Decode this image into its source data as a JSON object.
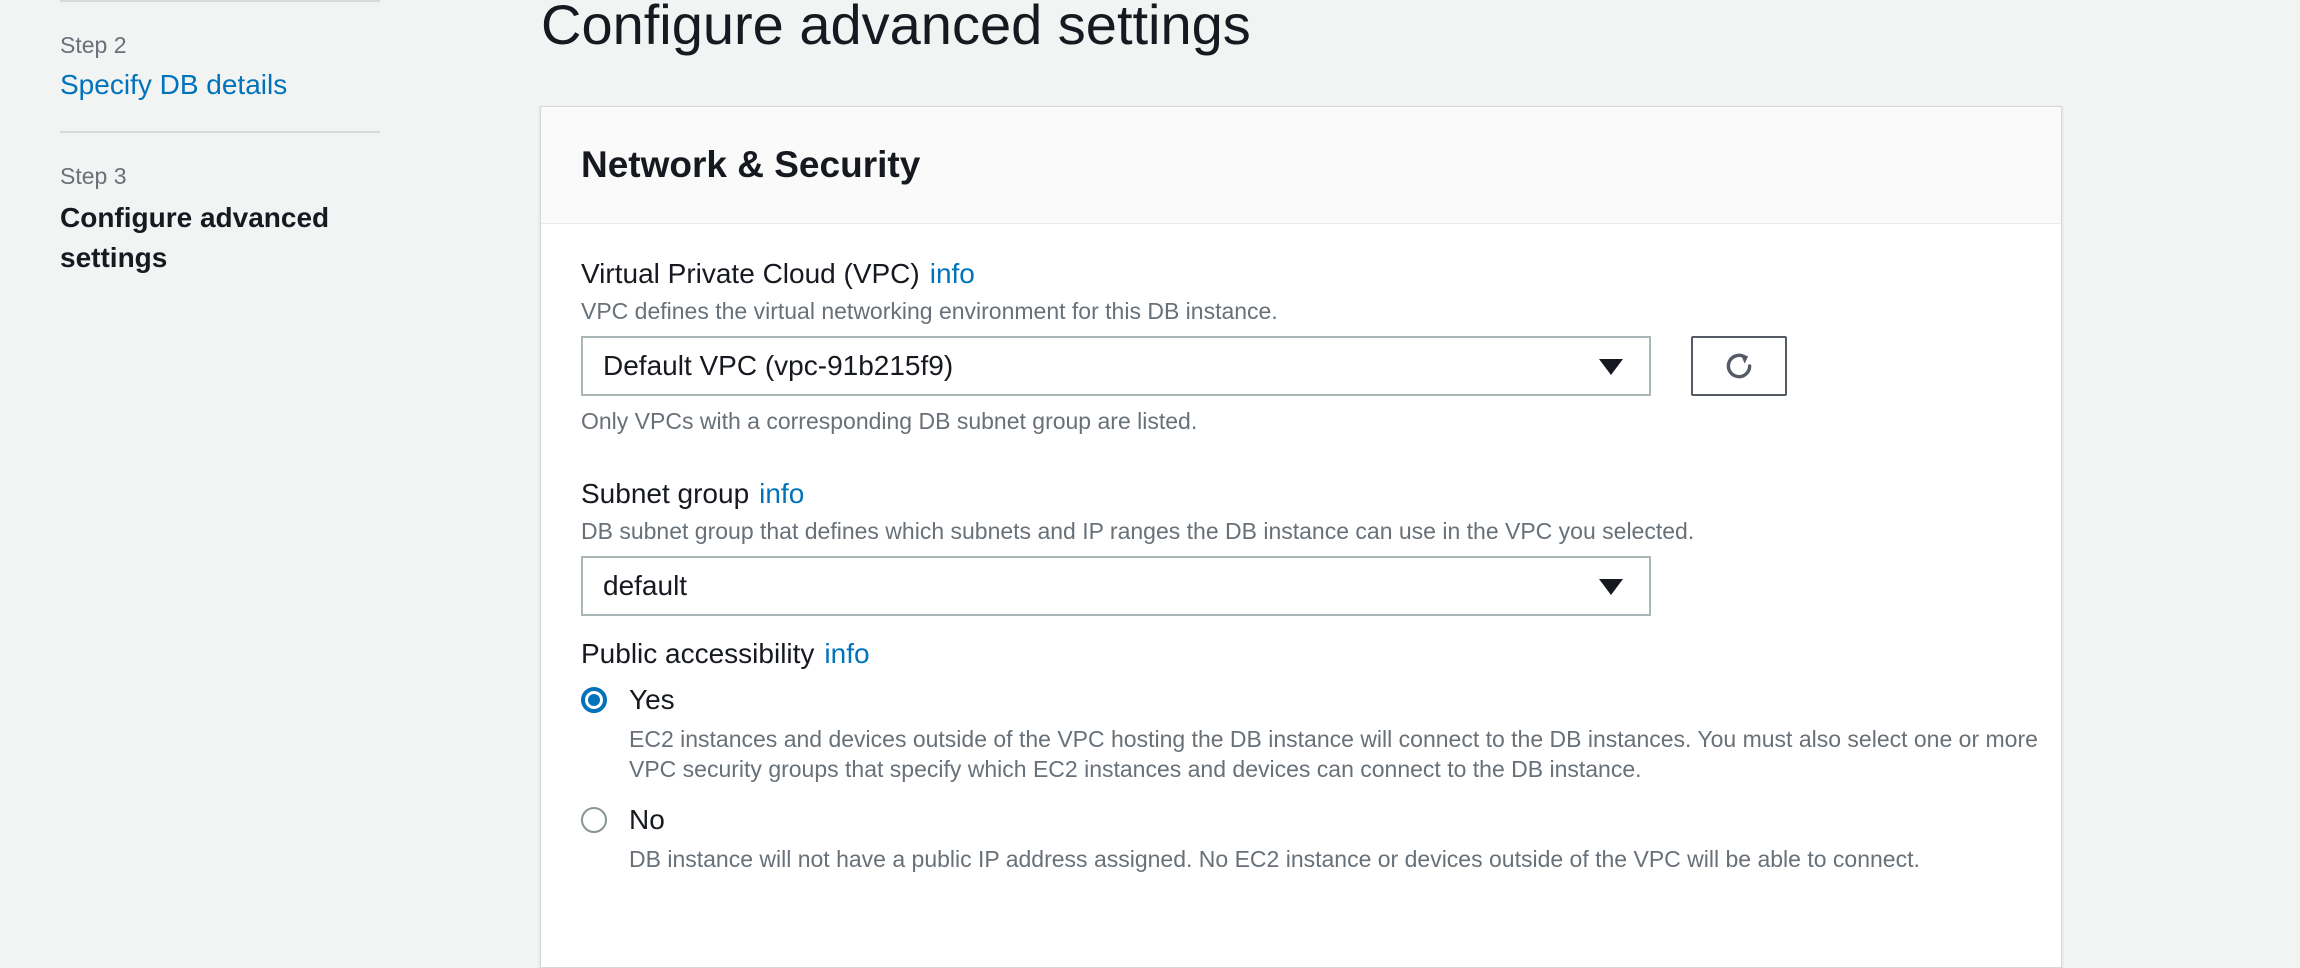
{
  "sidebar": {
    "steps": [
      {
        "number": "Step 2",
        "label": "Specify DB details"
      },
      {
        "number": "Step 3",
        "label": "Configure advanced settings"
      }
    ]
  },
  "page": {
    "title": "Configure advanced settings"
  },
  "network_security": {
    "title": "Network & Security",
    "vpc": {
      "label": "Virtual Private Cloud (VPC)",
      "info": "info",
      "description": "VPC defines the virtual networking environment for this DB instance.",
      "value": "Default VPC (vpc-91b215f9)",
      "hint": "Only VPCs with a corresponding DB subnet group are listed."
    },
    "subnet": {
      "label": "Subnet group",
      "info": "info",
      "description": "DB subnet group that defines which subnets and IP ranges the DB instance can use in the VPC you selected.",
      "value": "default"
    },
    "public_access": {
      "label": "Public accessibility",
      "info": "info",
      "selected": "Yes",
      "options": [
        {
          "label": "Yes",
          "description": "EC2 instances and devices outside of the VPC hosting the DB instance will connect to the DB instances. You must also select one or more VPC security groups that specify which EC2 instances and devices can connect to the DB instance."
        },
        {
          "label": "No",
          "description": "DB instance will not have a public IP address assigned. No EC2 instance or devices outside of the VPC will be able to connect."
        }
      ]
    }
  },
  "colors": {
    "accent": "#0073bb",
    "text": "#16191f",
    "muted": "#687078",
    "background": "#f2f3f3"
  },
  "icons": {
    "refresh": "refresh-icon",
    "dropdown": "caret-down-icon"
  }
}
